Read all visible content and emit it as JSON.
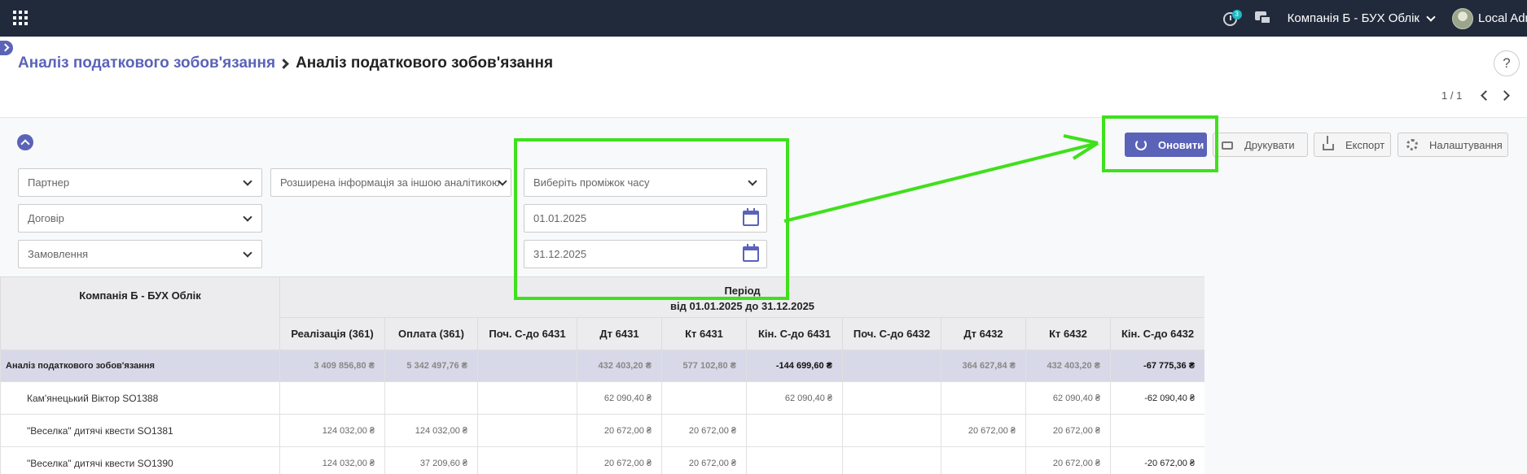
{
  "navbar": {
    "apps_icon": "apps-grid-icon",
    "activity_badge": "3",
    "company": "Компанія Б - БУХ Облік",
    "user": "Local Adm"
  },
  "breadcrumb": {
    "parent": "Аналіз податкового зобов'язання",
    "current": "Аналіз податкового зобов'язання"
  },
  "help_label": "?",
  "pager": {
    "value": "1 / 1"
  },
  "buttons": {
    "refresh": "Оновити",
    "print": "Друкувати",
    "export": "Експорт",
    "settings": "Налаштування"
  },
  "filters": {
    "partner": "Партнер",
    "contract": "Договір",
    "order": "Замовлення",
    "extended": "Розширена інформація за іншою аналітикою",
    "period_select": "Виберіть проміжок часу",
    "date_from": "01.01.2025",
    "date_to": "31.12.2025"
  },
  "table": {
    "company_header": "Компанія Б - БУХ Облік",
    "period_header": "Період",
    "period_range": "від 01.01.2025 до 31.12.2025",
    "columns": [
      "Реалізація (361)",
      "Оплата (361)",
      "Поч. С-до 6431",
      "Дт 6431",
      "Кт 6431",
      "Кін. С-до 6431",
      "Поч. С-до 6432",
      "Дт 6432",
      "Кт 6432",
      "Кін. С-до 6432"
    ],
    "rows": [
      {
        "name": "Аналіз податкового зобов'язання",
        "group": true,
        "cells": [
          "3 409 856,80 ₴",
          "5 342 497,76 ₴",
          "",
          "432 403,20 ₴",
          "577 102,80 ₴",
          "-144 699,60 ₴",
          "",
          "364 627,84 ₴",
          "432 403,20 ₴",
          "-67 775,36 ₴"
        ]
      },
      {
        "name": "Кам'янецький Віктор SO1388",
        "group": false,
        "cells": [
          "",
          "",
          "",
          "62 090,40 ₴",
          "",
          "62 090,40 ₴",
          "",
          "",
          "62 090,40 ₴",
          "-62 090,40 ₴"
        ]
      },
      {
        "name": "\"Веселка\" дитячі квести SO1381",
        "group": false,
        "cells": [
          "124 032,00 ₴",
          "124 032,00 ₴",
          "",
          "20 672,00 ₴",
          "20 672,00 ₴",
          "",
          "",
          "20 672,00 ₴",
          "20 672,00 ₴",
          ""
        ]
      },
      {
        "name": "\"Веселка\" дитячі квести SO1390",
        "group": false,
        "cells": [
          "124 032,00 ₴",
          "37 209,60 ₴",
          "",
          "20 672,00 ₴",
          "20 672,00 ₴",
          "",
          "",
          "",
          "20 672,00 ₴",
          "-20 672,00 ₴"
        ]
      }
    ]
  },
  "colors": {
    "accent": "#5a63b8",
    "navbar": "#212a3b",
    "highlight": "#3fe01c"
  }
}
